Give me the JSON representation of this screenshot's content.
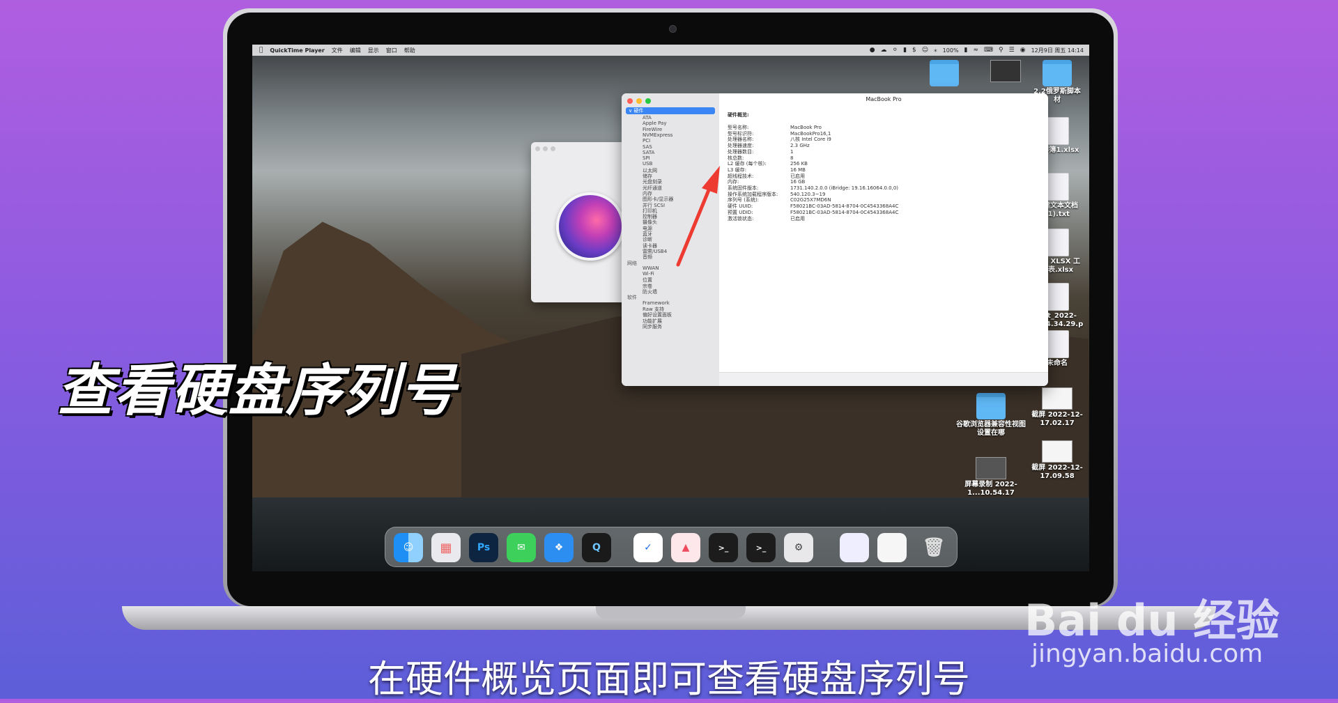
{
  "menubar": {
    "app_name": "QuickTime Player",
    "menus": [
      "文件",
      "编辑",
      "显示",
      "窗口",
      "帮助"
    ],
    "battery": "100%",
    "clock": "12月9日 周五 14:14"
  },
  "desktop_icons": [
    {
      "label": ""
    },
    {
      "label": ""
    },
    {
      "label": "2.2俄罗斯脚本材"
    },
    {
      "label": "工作簿1.xlsx"
    },
    {
      "label": "新建文本文档(1).txt"
    },
    {
      "label": "新建 XLSX 工作表.xlsx"
    },
    {
      "label": "hot_2022-1_14.34.29.p"
    },
    {
      "label": "未命名"
    },
    {
      "label": "谷歌浏览器兼容性视图设置在哪"
    },
    {
      "label": "截屏 2022-12-17.02.17"
    },
    {
      "label": "截屏 2022-12-17.09.58"
    },
    {
      "label": "屏幕录制 2022-1...10.54.17"
    }
  ],
  "sysinfo": {
    "title": "MacBook Pro",
    "sidebar": {
      "hardware": "硬件",
      "hardware_items": [
        "ATA",
        "Apple Pay",
        "FireWire",
        "NVMExpress",
        "PCI",
        "SAS",
        "SATA",
        "SPI",
        "USB",
        "以太网",
        "储存",
        "光盘刻录",
        "光纤通道",
        "内存",
        "图形卡/显示器",
        "并行 SCSI",
        "打印机",
        "控制器",
        "摄像头",
        "电源",
        "蓝牙",
        "诊断",
        "读卡器",
        "雷雳/USB4",
        "音频"
      ],
      "network": "网络",
      "network_items": [
        "WWAN",
        "Wi-Fi",
        "位置",
        "宗卷",
        "防火墙"
      ],
      "software": "软件",
      "software_items": [
        "Framework",
        "Raw 支持",
        "偏好设置面板",
        "功能扩展",
        "同步服务"
      ]
    },
    "section_title": "硬件概览:",
    "rows": [
      {
        "k": "型号名称:",
        "v": "MacBook Pro"
      },
      {
        "k": "型号标识符:",
        "v": "MacBookPro16,1"
      },
      {
        "k": "处理器名称:",
        "v": "八核 Intel Core i9"
      },
      {
        "k": "处理器速度:",
        "v": "2.3 GHz"
      },
      {
        "k": "处理器数目:",
        "v": "1"
      },
      {
        "k": "核总数:",
        "v": "8"
      },
      {
        "k": "L2 缓存 (每个核):",
        "v": "256 KB"
      },
      {
        "k": "L3 缓存:",
        "v": "16 MB"
      },
      {
        "k": "超线程技术:",
        "v": "已启用"
      },
      {
        "k": "内存:",
        "v": "16 GB"
      },
      {
        "k": "系统固件版本:",
        "v": "1731.140.2.0.0 (iBridge: 19.16.16064.0.0,0)"
      },
      {
        "k": "操作系统加载程序版本:",
        "v": "540.120.3~19"
      },
      {
        "k": "序列号 (系统):",
        "v": "C02G25X7MD6N"
      },
      {
        "k": "硬件 UUID:",
        "v": "F58021BC-03AD-5814-8704-0C4543368A4C"
      },
      {
        "k": "预置 UDID:",
        "v": "F58021BC-03AD-5814-8704-0C4543368A4C"
      },
      {
        "k": "激活锁状态:",
        "v": "已启用"
      }
    ]
  },
  "dock": {
    "apps": [
      "finder",
      "launchpad",
      "photoshop",
      "messages",
      "safari",
      "quicktime",
      "app-blue",
      "app-red",
      "terminal",
      "terminal",
      "system-info",
      "preview",
      "screenshot",
      "trash"
    ],
    "ps_label": "Ps",
    "terminal_label": ">_"
  },
  "overlay": {
    "title": "查看硬盘序列号",
    "subtitle": "在硬件概览页面即可查看硬盘序列号"
  },
  "watermark": {
    "brand": "Bai du 经验",
    "url": "jingyan.baidu.com"
  }
}
